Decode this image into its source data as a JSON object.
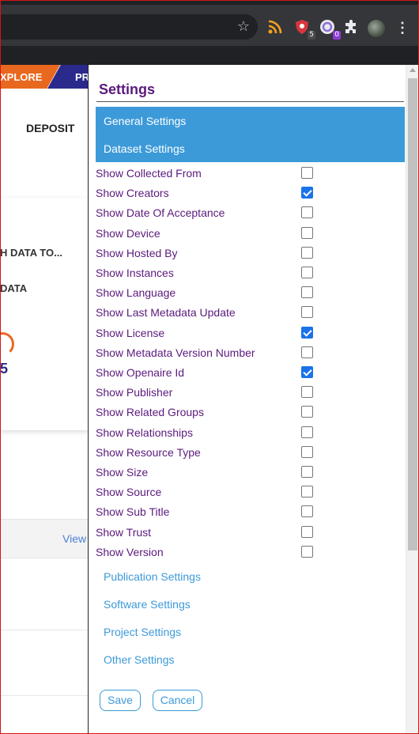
{
  "browser": {
    "star_icon": "star-icon",
    "extensions": [
      {
        "name": "rss-icon",
        "color": "#f7a21b"
      },
      {
        "name": "privacy-badger-icon",
        "badge": "5",
        "color": "#d9363e"
      },
      {
        "name": "extension-o-icon",
        "badge": "0",
        "color": "#8e6fd8"
      }
    ],
    "puzzle_icon": "puzzle-icon",
    "menu_icon": "kebab-menu-icon"
  },
  "background_page": {
    "nav": {
      "explore": "XPLORE",
      "second": "PR"
    },
    "deposit": "DEPOSIT",
    "card": {
      "line1": "H DATA TO...",
      "line2": "DATA",
      "number": "5"
    },
    "view_link": "View"
  },
  "settings": {
    "title": "Settings",
    "general_label": "General Settings",
    "dataset_label": "Dataset Settings",
    "dataset_options": [
      {
        "label": "Show Collected From",
        "checked": false
      },
      {
        "label": "Show Creators",
        "checked": true
      },
      {
        "label": "Show Date Of Acceptance",
        "checked": false
      },
      {
        "label": "Show Device",
        "checked": false
      },
      {
        "label": "Show Hosted By",
        "checked": false
      },
      {
        "label": "Show Instances",
        "checked": false
      },
      {
        "label": "Show Language",
        "checked": false
      },
      {
        "label": "Show Last Metadata Update",
        "checked": false
      },
      {
        "label": "Show License",
        "checked": true
      },
      {
        "label": "Show Metadata Version Number",
        "checked": false
      },
      {
        "label": "Show Openaire Id",
        "checked": true
      },
      {
        "label": "Show Publisher",
        "checked": false
      },
      {
        "label": "Show Related Groups",
        "checked": false
      },
      {
        "label": "Show Relationships",
        "checked": false
      },
      {
        "label": "Show Resource Type",
        "checked": false
      },
      {
        "label": "Show Size",
        "checked": false
      },
      {
        "label": "Show Source",
        "checked": false
      },
      {
        "label": "Show Sub Title",
        "checked": false
      },
      {
        "label": "Show Trust",
        "checked": false
      },
      {
        "label": "Show Version",
        "checked": false
      }
    ],
    "other_sections": [
      "Publication Settings",
      "Software Settings",
      "Project Settings",
      "Other Settings"
    ],
    "save_label": "Save",
    "cancel_label": "Cancel"
  },
  "colors": {
    "accent": "#3c9ad9",
    "title_purple": "#5b1a7d",
    "checkbox_checked": "#1a73e8",
    "explore_orange": "#e9681f",
    "nav_blue": "#2a2a8c"
  }
}
